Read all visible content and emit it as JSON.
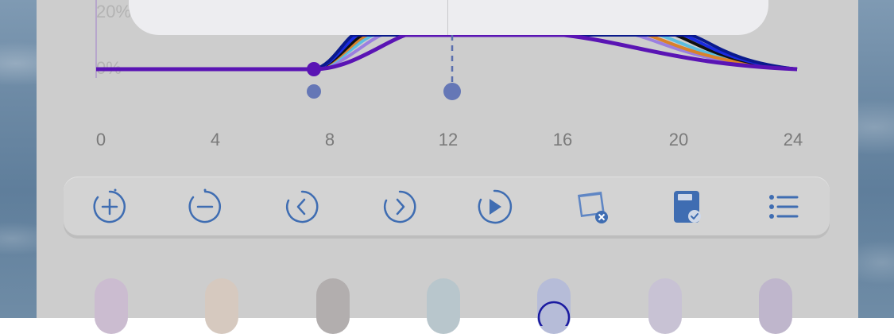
{
  "chart": {
    "y_labels": [
      "20%",
      "0%"
    ],
    "x_ticks": [
      "0",
      "4",
      "8",
      "12",
      "16",
      "20",
      "24"
    ],
    "series_colors": [
      "#5a14b4",
      "#0a1a8c",
      "#1a2be0",
      "#111111",
      "#d9822b",
      "#5bbde0",
      "#9b7fe0"
    ]
  },
  "toolbar": {
    "buttons": [
      {
        "name": "zoom-in-button",
        "icon": "plus-circle-icon"
      },
      {
        "name": "zoom-out-button",
        "icon": "minus-circle-icon"
      },
      {
        "name": "previous-button",
        "icon": "chevron-left-icon"
      },
      {
        "name": "next-button",
        "icon": "chevron-right-icon"
      },
      {
        "name": "play-button",
        "icon": "play-icon"
      },
      {
        "name": "clear-button",
        "icon": "square-x-icon"
      },
      {
        "name": "save-button",
        "icon": "save-check-icon"
      },
      {
        "name": "list-button",
        "icon": "list-icon"
      }
    ],
    "accent": "#3f6db2"
  },
  "swatches": [
    "#cbbcd0",
    "#d6c9bf",
    "#b2aeae",
    "#b8c6cc",
    "#b6bcd8",
    "#c8c2d4",
    "#bfb6cc"
  ],
  "selected_swatch_index": 4
}
